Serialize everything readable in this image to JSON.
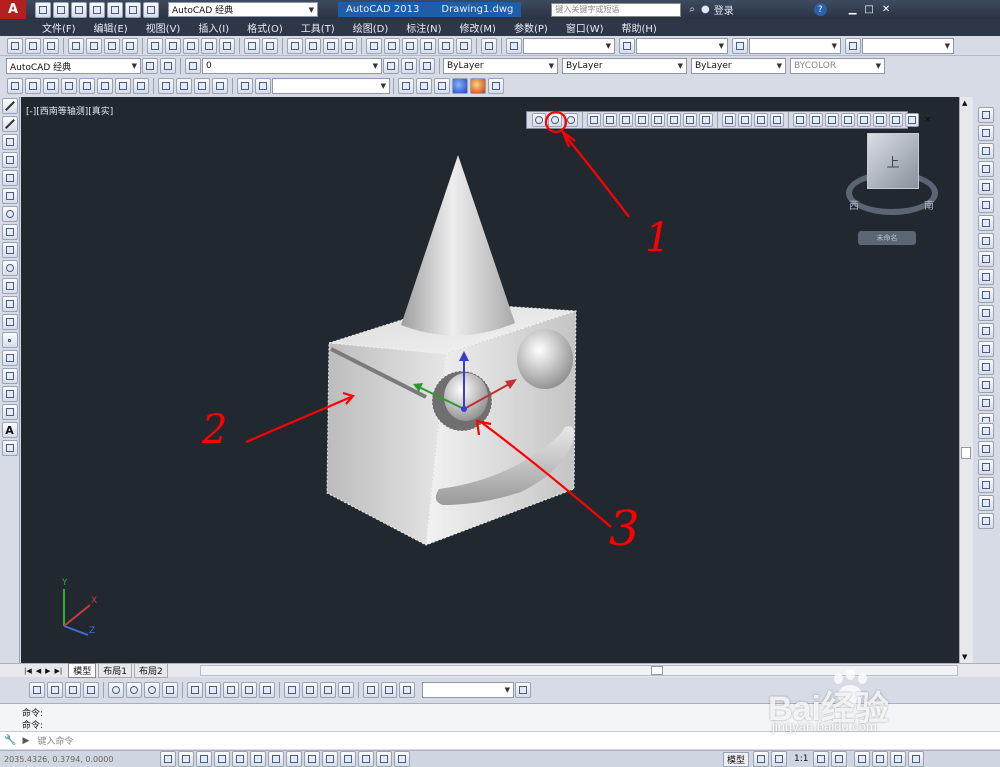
{
  "title_bar": {
    "workspace": "AutoCAD 经典",
    "app_name": "AutoCAD 2013",
    "doc_name": "Drawing1.dwg",
    "search_placeholder": "键入关键字或短语",
    "login": "登录"
  },
  "menu": [
    "文件(F)",
    "编辑(E)",
    "视图(V)",
    "插入(I)",
    "格式(O)",
    "工具(T)",
    "绘图(D)",
    "标注(N)",
    "修改(M)",
    "参数(P)",
    "窗口(W)",
    "帮助(H)"
  ],
  "toolbar2": {
    "workspace_combo": "AutoCAD 经典",
    "layer_combo": "0",
    "color_combo": "ByLayer",
    "linetype_combo": "ByLayer",
    "lineweight_combo": "ByLayer",
    "plotstyle_combo": "BYCOLOR"
  },
  "viewport": {
    "label": "[-][西南等轴测][真实]",
    "viewcube_face": "上",
    "viewcube_west": "西",
    "viewcube_south": "南",
    "viewcube_unnamed": "未命名",
    "ucs_x": "X",
    "ucs_y": "Y",
    "ucs_z": "Z",
    "background": "#212830"
  },
  "annotations": {
    "label_1": "1",
    "label_2": "2",
    "label_3": "3",
    "color": "#ff0000"
  },
  "tabs": [
    "模型",
    "布局1",
    "布局2"
  ],
  "command": {
    "history": [
      "命令:",
      "命令:"
    ],
    "placeholder": "键入命令"
  },
  "status": {
    "coords": "2035.4326, 0.3794, 0.0000",
    "model": "模型",
    "scale": "1:1"
  },
  "watermark": {
    "brand": "Bai经验",
    "url": "jingyan.baidu.com"
  }
}
